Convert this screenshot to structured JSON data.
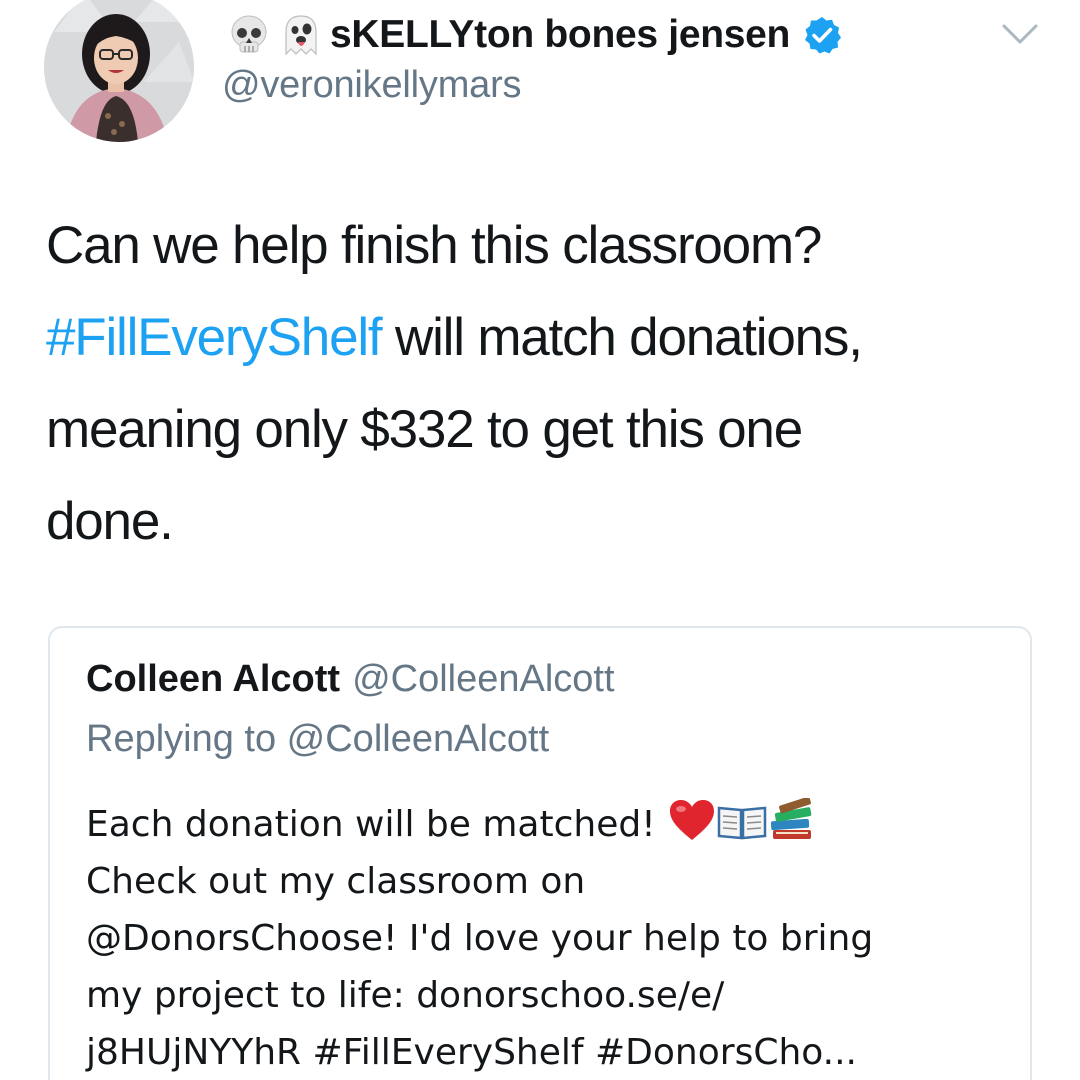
{
  "author": {
    "display_name": "sKELLYton bones jensen",
    "handle": "@veronikellymars",
    "name_emoji": [
      "skull-emoji",
      "ghost-emoji"
    ],
    "verified": true
  },
  "tweet": {
    "line1": "Can we help finish this classroom?",
    "hashtag": "#FillEveryShelf",
    "line2_rest": " will match donations,",
    "line3": "meaning only $332 to get this one",
    "line4": "done."
  },
  "quoted_tweet": {
    "name": "Colleen Alcott",
    "handle": "@ColleenAlcott",
    "replying_to": "Replying to @ColleenAlcott",
    "line1": "Each donation will be matched! ",
    "line1_emoji": [
      "heart-emoji",
      "open-book-emoji",
      "books-emoji"
    ],
    "line2": "Check out my classroom on",
    "line3": "@DonorsChoose! I'd love your help to bring",
    "line4": "my project to life:  donorschoo.se/e/",
    "line5": "j8HUjNYYhR    #FillEveryShelf #DonorsCho..."
  },
  "colors": {
    "link": "#1da1f2",
    "text": "#14171a",
    "secondary": "#657786",
    "verified": "#1da1f2",
    "card_border": "#e1e8ed"
  }
}
